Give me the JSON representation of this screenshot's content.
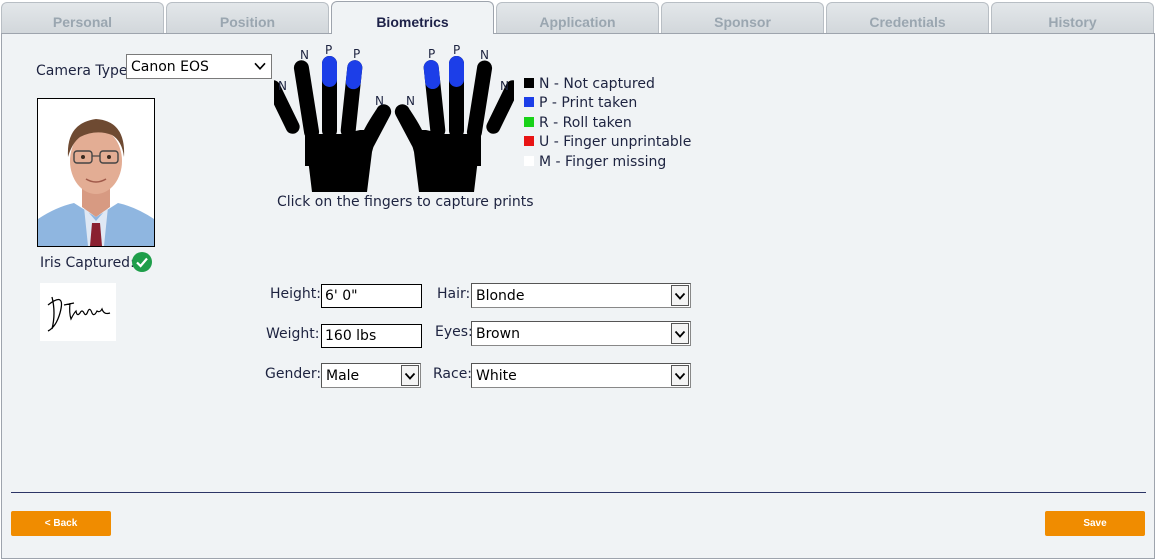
{
  "tabs": [
    {
      "label": "Personal",
      "active": false
    },
    {
      "label": "Position",
      "active": false
    },
    {
      "label": "Biometrics",
      "active": true
    },
    {
      "label": "Application",
      "active": false
    },
    {
      "label": "Sponsor",
      "active": false
    },
    {
      "label": "Credentials",
      "active": false
    },
    {
      "label": "History",
      "active": false
    }
  ],
  "camera": {
    "label": "Camera Type:",
    "value": "Canon EOS"
  },
  "iris": {
    "label": "Iris Captured:",
    "icon": "check-circle-icon",
    "color": "#1e9e4a"
  },
  "fingers": {
    "left_hand": [
      "N",
      "N",
      "P",
      "P",
      "N"
    ],
    "right_hand": [
      "N",
      "P",
      "P",
      "N",
      "N"
    ],
    "instruction": "Click on the fingers to capture prints"
  },
  "legend": [
    {
      "text": "N - Not captured",
      "color": "#000000"
    },
    {
      "text": "P - Print taken",
      "color": "#1c3ee8"
    },
    {
      "text": "R - Roll taken",
      "color": "#19d219"
    },
    {
      "text": "U - Finger unprintable",
      "color": "#e81414"
    },
    {
      "text": "M - Finger missing",
      "color": "#ffffff"
    }
  ],
  "fields": {
    "height": {
      "label": "Height:",
      "value": "6' 0\""
    },
    "weight": {
      "label": "Weight:",
      "value": "160 lbs"
    },
    "gender": {
      "label": "Gender:",
      "value": "Male"
    },
    "hair": {
      "label": "Hair:",
      "value": "Blonde"
    },
    "eyes": {
      "label": "Eyes:",
      "value": "Brown"
    },
    "race": {
      "label": "Race:",
      "value": "White"
    }
  },
  "buttons": {
    "back": "< Back",
    "save": "Save"
  },
  "colors": {
    "print": "#1c3ee8",
    "not_captured": "#000000",
    "accent": "#f08c00"
  }
}
